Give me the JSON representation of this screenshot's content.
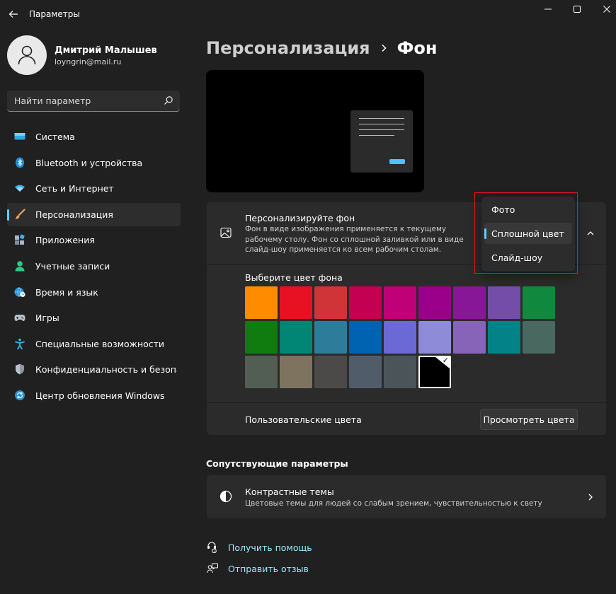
{
  "window": {
    "title": "Параметры"
  },
  "profile": {
    "name": "Дмитрий Малышев",
    "email": "loyngrin@mail.ru"
  },
  "search": {
    "placeholder": "Найти параметр"
  },
  "nav": {
    "items": [
      {
        "label": "Система",
        "icon": "monitor-icon",
        "active": false
      },
      {
        "label": "Bluetooth и устройства",
        "icon": "bluetooth-icon",
        "active": false
      },
      {
        "label": "Сеть и Интернет",
        "icon": "wifi-icon",
        "active": false
      },
      {
        "label": "Персонализация",
        "icon": "brush-icon",
        "active": true
      },
      {
        "label": "Приложения",
        "icon": "apps-icon",
        "active": false
      },
      {
        "label": "Учетные записи",
        "icon": "account-icon",
        "active": false
      },
      {
        "label": "Время и язык",
        "icon": "globe-clock-icon",
        "active": false
      },
      {
        "label": "Игры",
        "icon": "gamepad-icon",
        "active": false
      },
      {
        "label": "Специальные возможности",
        "icon": "accessibility-icon",
        "active": false
      },
      {
        "label": "Конфиденциальность и безопасность",
        "icon": "shield-icon",
        "active": false
      },
      {
        "label": "Центр обновления Windows",
        "icon": "update-icon",
        "active": false
      }
    ]
  },
  "breadcrumb": {
    "parent": "Персонализация",
    "current": "Фон"
  },
  "background_card": {
    "title": "Персонализируйте фон",
    "description": "Фон в виде изображения применяется к текущему рабочему столу. Фон со сплошной заливкой или в виде слайд-шоу применяется ко всем рабочим столам."
  },
  "dropdown": {
    "options": [
      "Фото",
      "Сплошной цвет",
      "Слайд-шоу"
    ],
    "selected": "Сплошной цвет"
  },
  "colors": {
    "title": "Выберите цвет фона",
    "swatches": [
      "#ff8c00",
      "#e81123",
      "#d13438",
      "#c30052",
      "#bf0077",
      "#9a0089",
      "#881798",
      "#744da9",
      "#10893e",
      "#107c10",
      "#018574",
      "#2d7d9a",
      "#0063b1",
      "#6b69d6",
      "#8e8cd8",
      "#8764b8",
      "#038387",
      "#486860",
      "#525e54",
      "#7e735f",
      "#4c4a48",
      "#515c6b",
      "#4a5459",
      "#000000"
    ],
    "selected_index": 23
  },
  "custom_colors": {
    "label": "Пользовательские цвета",
    "button": "Просмотреть цвета"
  },
  "related": {
    "title": "Сопутствующие параметры",
    "contrast_title": "Контрастные темы",
    "contrast_desc": "Цветовые темы для людей со слабым зрением, чувствительностью к свету"
  },
  "links": {
    "help": "Получить помощь",
    "feedback": "Отправить отзыв"
  },
  "colors_theme": {
    "accent": "#60cdff",
    "link": "#99ebff",
    "highlight": "#e81123"
  }
}
